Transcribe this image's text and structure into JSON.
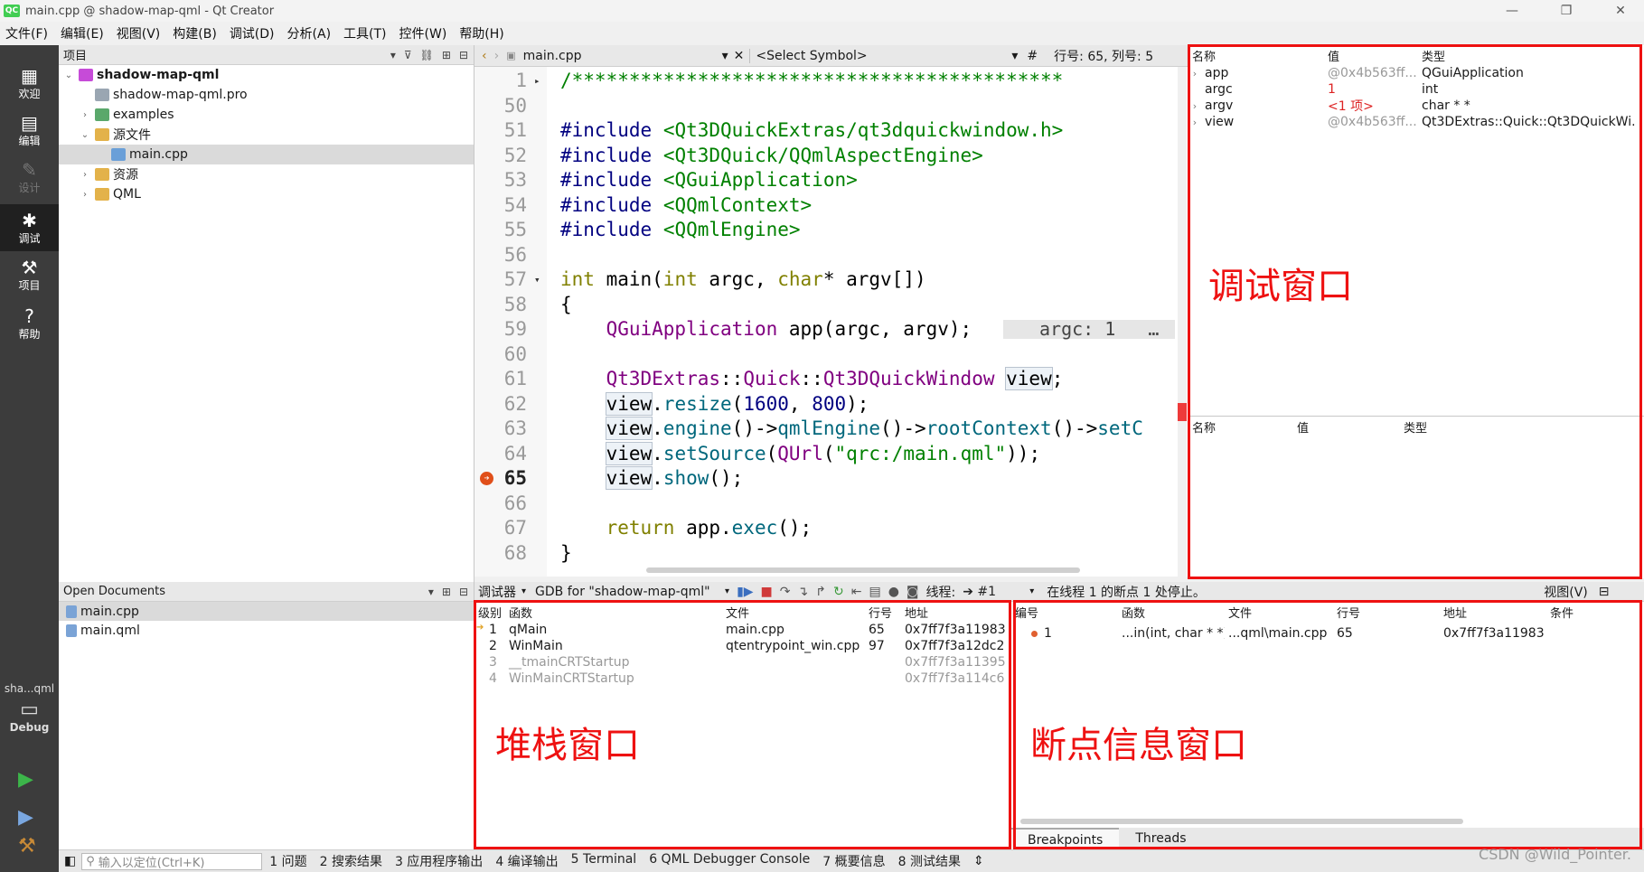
{
  "window": {
    "title": "main.cpp @ shadow-map-qml - Qt Creator",
    "logo": "QC"
  },
  "window_controls": {
    "minimize": "—",
    "maximize": "❐",
    "close": "✕"
  },
  "menubar": [
    "文件(F)",
    "编辑(E)",
    "视图(V)",
    "构建(B)",
    "调试(D)",
    "分析(A)",
    "工具(T)",
    "控件(W)",
    "帮助(H)"
  ],
  "modes": [
    {
      "label": "欢迎",
      "icon": "grid-icon"
    },
    {
      "label": "编辑",
      "icon": "document-icon"
    },
    {
      "label": "设计",
      "icon": "pencil-icon"
    },
    {
      "label": "调试",
      "icon": "bug-icon"
    },
    {
      "label": "项目",
      "icon": "wrench-icon"
    },
    {
      "label": "帮助",
      "icon": "help-icon"
    }
  ],
  "kit": {
    "project": "sha...qml",
    "build": "Debug"
  },
  "project_panel": {
    "title": "项目",
    "tree": [
      {
        "label": "shadow-map-qml",
        "arrow": "⌄",
        "bold": true
      },
      {
        "label": "shadow-map-qml.pro",
        "arrow": ""
      },
      {
        "label": "examples",
        "arrow": "›"
      },
      {
        "label": "源文件",
        "arrow": "⌄"
      },
      {
        "label": "main.cpp",
        "arrow": "",
        "selected": true
      },
      {
        "label": "资源",
        "arrow": "›"
      },
      {
        "label": "QML",
        "arrow": "›"
      }
    ]
  },
  "open_documents": {
    "title": "Open Documents",
    "files": [
      "main.cpp",
      "main.qml"
    ]
  },
  "editor_toolbar": {
    "file": "main.cpp",
    "symbol": "<Select Symbol>",
    "hash": "#",
    "position": "行号: 65, 列号: 5"
  },
  "code_lines": [
    {
      "n": "1",
      "html": "<span class='c-cmt'>/*******************************************</span>",
      "fold": "▸"
    },
    {
      "n": "50",
      "html": ""
    },
    {
      "n": "51",
      "html": "<span class='c-pp'>#include</span> <span class='c-inc'>&lt;Qt3DQuickExtras/qt3dquickwindow.h&gt;</span>"
    },
    {
      "n": "52",
      "html": "<span class='c-pp'>#include</span> <span class='c-inc'>&lt;Qt3DQuick/QQmlAspectEngine&gt;</span>"
    },
    {
      "n": "53",
      "html": "<span class='c-pp'>#include</span> <span class='c-inc'>&lt;QGuiApplication&gt;</span>"
    },
    {
      "n": "54",
      "html": "<span class='c-pp'>#include</span> <span class='c-inc'>&lt;QQmlContext&gt;</span>"
    },
    {
      "n": "55",
      "html": "<span class='c-pp'>#include</span> <span class='c-inc'>&lt;QQmlEngine&gt;</span>"
    },
    {
      "n": "56",
      "html": ""
    },
    {
      "n": "57",
      "html": "<span class='c-kw'>int</span> main(<span class='c-kw'>int</span> argc, <span class='c-kw'>char</span>* argv[])",
      "fold": "▾"
    },
    {
      "n": "58",
      "html": "{"
    },
    {
      "n": "59",
      "html": "    <span class='c-type'>QGuiApplication</span> app(argc, argv);",
      "inline": "argc: 1   …"
    },
    {
      "n": "60",
      "html": ""
    },
    {
      "n": "61",
      "html": "    <span class='c-type'>Qt3DExtras</span>::<span class='c-type'>Quick</span>::<span class='c-type'>Qt3DQuickWindow</span> <span class='c-var'>view</span>;"
    },
    {
      "n": "62",
      "html": "    <span class='c-var'>view</span>.<span class='c-fn'>resize</span>(<span class='c-num'>1600</span>, <span class='c-num'>800</span>);"
    },
    {
      "n": "63",
      "html": "    <span class='c-var'>view</span>.<span class='c-fn'>engine</span>()-&gt;<span class='c-fn'>qmlEngine</span>()-&gt;<span class='c-fn'>rootContext</span>()-&gt;<span class='c-fn'>setC</span>"
    },
    {
      "n": "64",
      "html": "    <span class='c-var'>view</span>.<span class='c-fn'>setSource</span>(<span class='c-type'>QUrl</span>(<span class='c-str'>\"qrc:/main.qml\"</span>));"
    },
    {
      "n": "65",
      "html": "    <span class='c-var'>view</span>.<span class='c-fn'>show</span>();",
      "breakpoint": true
    },
    {
      "n": "66",
      "html": ""
    },
    {
      "n": "67",
      "html": "    <span class='c-kw'>return</span> app.<span class='c-fn'>exec</span>();"
    },
    {
      "n": "68",
      "html": "}"
    }
  ],
  "locals": {
    "headers": [
      "名称",
      "值",
      "类型"
    ],
    "rows": [
      {
        "name": "app",
        "value": "@0x4b563ff...",
        "type": "QGuiApplication",
        "arrow": "›",
        "valcolor": "#999999"
      },
      {
        "name": "argc",
        "value": "1",
        "type": "int",
        "arrow": "",
        "valcolor": "#dd2222"
      },
      {
        "name": "argv",
        "value": "<1 项>",
        "type": "char * *",
        "arrow": "›",
        "valcolor": "#dd2222"
      },
      {
        "name": "view",
        "value": "@0x4b563ff...",
        "type": "Qt3DExtras::Quick::Qt3DQuickWi...",
        "arrow": "›",
        "valcolor": "#999999"
      }
    ]
  },
  "expressions": {
    "headers": [
      "名称",
      "值",
      "类型"
    ]
  },
  "debug_toolbar": {
    "debugger": "调试器",
    "engine": "GDB for \"shadow-map-qml\"",
    "thread_label": "线程:",
    "thread": "➔ #1",
    "status": "在线程 1 的断点 1 处停止。",
    "view": "视图(V)"
  },
  "stack": {
    "headers": [
      "级别",
      "函数",
      "文件",
      "行号",
      "地址"
    ],
    "rows": [
      {
        "level": "1",
        "func": "qMain",
        "file": "main.cpp",
        "line": "65",
        "addr": "0x7ff7f3a11983",
        "current": true
      },
      {
        "level": "2",
        "func": "WinMain",
        "file": "qtentrypoint_win.cpp",
        "line": "97",
        "addr": "0x7ff7f3a12dc2"
      },
      {
        "level": "3",
        "func": "__tmainCRTStartup",
        "file": "",
        "line": "",
        "addr": "0x7ff7f3a11395",
        "dim": true
      },
      {
        "level": "4",
        "func": "WinMainCRTStartup",
        "file": "",
        "line": "",
        "addr": "0x7ff7f3a114c6",
        "dim": true
      }
    ]
  },
  "breakpoints": {
    "headers": [
      "编号",
      "函数",
      "文件",
      "行号",
      "地址",
      "条件"
    ],
    "rows": [
      {
        "id": "1",
        "func": "...in(int, char * *)",
        "file": "...qml\\main.cpp",
        "line": "65",
        "addr": "0x7ff7f3a11983",
        "cond": ""
      }
    ],
    "tabs": [
      "Breakpoints",
      "Threads"
    ]
  },
  "statusbar": {
    "locator_placeholder": "输入以定位(Ctrl+K)",
    "panes": [
      "1 问题",
      "2 搜索结果",
      "3 应用程序输出",
      "4 编译输出",
      "5 Terminal",
      "6 QML Debugger Console",
      "7 概要信息",
      "8 测试结果"
    ]
  },
  "annotations": {
    "debug_window": "调试窗口",
    "stack_window": "堆栈窗口",
    "breakpoint_window": "断点信息窗口",
    "color": "#ee1111"
  },
  "watermark": "CSDN @Wild_Pointer."
}
